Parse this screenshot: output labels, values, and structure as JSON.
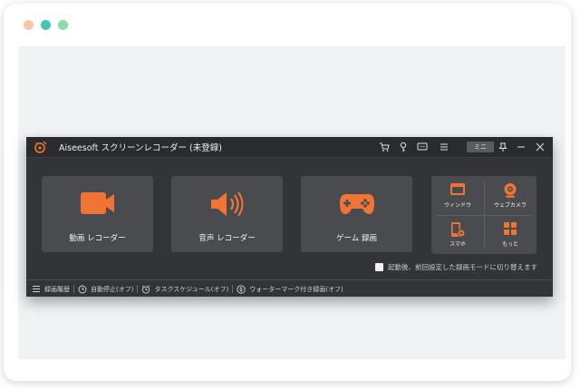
{
  "window": {
    "dots": [
      "#f6c9a4",
      "#3ec8b0",
      "#86dfa8"
    ]
  },
  "app": {
    "title": "Aiseesoft スクリーンレコーダー (未登録)",
    "accent_color": "#f07535",
    "mini_label": "ミニ"
  },
  "cards": [
    {
      "label": "動画 レコーダー",
      "icon": "video-camera-icon"
    },
    {
      "label": "音声 レコーダー",
      "icon": "speaker-icon"
    },
    {
      "label": "ゲーム 録画",
      "icon": "gamepad-icon"
    }
  ],
  "grid": [
    {
      "label": "ウィンドウ",
      "icon": "window-icon"
    },
    {
      "label": "ウェブカメラ",
      "icon": "webcam-icon"
    },
    {
      "label": "スマホ",
      "icon": "phone-icon"
    },
    {
      "label": "もっと",
      "icon": "more-grid-icon"
    }
  ],
  "auto_switch": {
    "label": "起動後、前回設定した録画モードに切り替えます"
  },
  "bottombar": {
    "history": "録画履歴",
    "auto_stop": "自動停止(オフ)",
    "task_schedule": "タスクスケジュール(オフ)",
    "watermark": "ウォーターマーク付き録画(オフ)"
  }
}
